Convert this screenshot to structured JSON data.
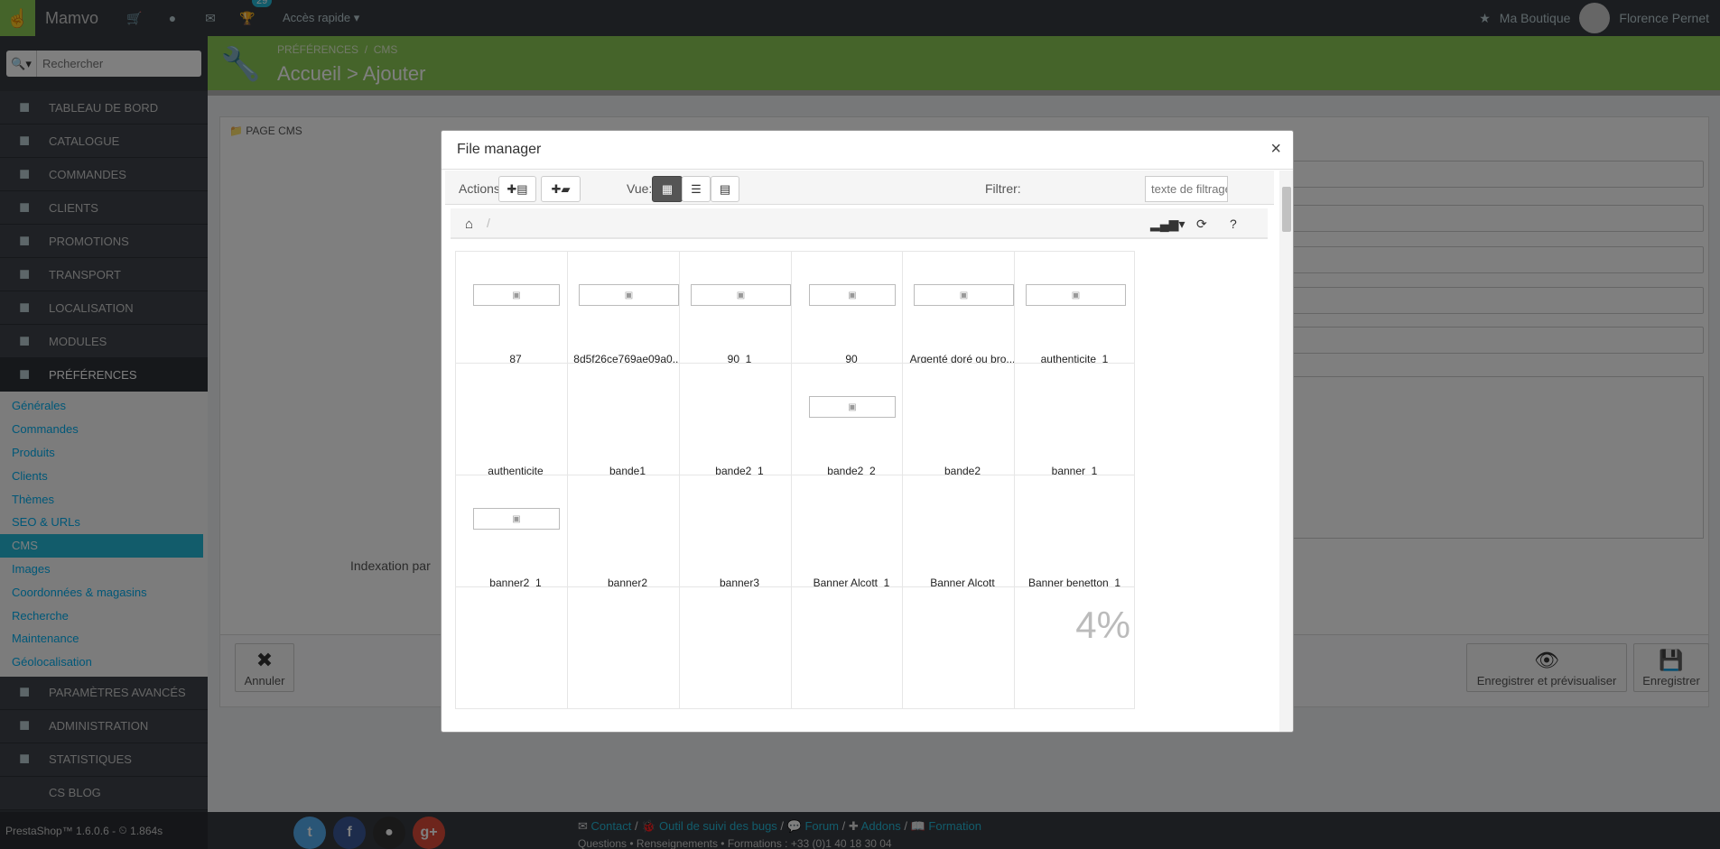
{
  "topbar": {
    "app_name": "Mamvo",
    "notif_count": "29",
    "quick_access": "Accès rapide",
    "shop_link": "Ma Boutique",
    "user_name": "Florence Pernet"
  },
  "search": {
    "placeholder": "Rechercher"
  },
  "menu": [
    {
      "label": "TABLEAU DE BORD",
      "icon": "dashboard-icon"
    },
    {
      "label": "CATALOGUE",
      "icon": "book-icon"
    },
    {
      "label": "COMMANDES",
      "icon": "credit-card-icon"
    },
    {
      "label": "CLIENTS",
      "icon": "users-icon"
    },
    {
      "label": "PROMOTIONS",
      "icon": "tags-icon"
    },
    {
      "label": "TRANSPORT",
      "icon": "truck-icon"
    },
    {
      "label": "LOCALISATION",
      "icon": "globe-icon"
    },
    {
      "label": "MODULES",
      "icon": "puzzle-icon"
    },
    {
      "label": "PRÉFÉRENCES",
      "icon": "wrench-icon"
    }
  ],
  "submenu": [
    "Générales",
    "Commandes",
    "Produits",
    "Clients",
    "Thèmes",
    "SEO & URLs",
    "CMS",
    "Images",
    "Coordonnées & magasins",
    "Recherche",
    "Maintenance",
    "Géolocalisation"
  ],
  "menu2": [
    {
      "label": "PARAMÈTRES AVANCÉS",
      "icon": "cogs-icon"
    },
    {
      "label": "ADMINISTRATION",
      "icon": "cog-icon"
    },
    {
      "label": "STATISTIQUES",
      "icon": "bar-chart-icon"
    },
    {
      "label": "CS BLOG",
      "icon": ""
    }
  ],
  "status": {
    "version": "PrestaShop™ 1.6.0.6 - ",
    "time": "1.864s"
  },
  "header": {
    "breadcrumb_1": "PRÉFÉRENCES",
    "breadcrumb_sep": "/",
    "breadcrumb_2": "CMS",
    "title": "Accueil > Ajouter"
  },
  "panel": {
    "heading": "PAGE CMS",
    "indexation_label": "Indexation par"
  },
  "buttons": {
    "cancel": "Annuler",
    "save_preview": "Enregistrer et prévisualiser",
    "save": "Enregistrer"
  },
  "footer": {
    "contact": "Contact",
    "bug_tracker": "Outil de suivi des bugs",
    "forum": "Forum",
    "addons": "Addons",
    "training": "Formation",
    "sub": "Questions • Renseignements • Formations : +33 (0)1 40 18 30 04"
  },
  "modal": {
    "title": "File manager",
    "close": "×",
    "actions_label": "Actions:",
    "view_label": "Vue:",
    "filter_label": "Filtrer:",
    "filter_placeholder": "texte de filtrage",
    "path_sep": "/",
    "loading_pct": "4%",
    "files": [
      {
        "name": "87",
        "thumb": true
      },
      {
        "name": "8d5f26ce769ae09a0...",
        "thumb": true
      },
      {
        "name": "90_1",
        "thumb": true
      },
      {
        "name": "90",
        "thumb": true
      },
      {
        "name": "Argenté doré ou bro...",
        "thumb": true
      },
      {
        "name": "authenticite_1",
        "thumb": true
      },
      {
        "name": "authenticite",
        "thumb": false
      },
      {
        "name": "bande1",
        "thumb": false
      },
      {
        "name": "bande2_1",
        "thumb": false
      },
      {
        "name": "bande2_2",
        "thumb": true
      },
      {
        "name": "bande2",
        "thumb": false
      },
      {
        "name": "banner_1",
        "thumb": false
      },
      {
        "name": "banner2_1",
        "thumb": true
      },
      {
        "name": "banner2",
        "thumb": false
      },
      {
        "name": "banner3",
        "thumb": false
      },
      {
        "name": "Banner Alcott_1",
        "thumb": false
      },
      {
        "name": "Banner Alcott",
        "thumb": false
      },
      {
        "name": "Banner benetton_1",
        "thumb": false
      },
      {
        "name": "",
        "thumb": false
      },
      {
        "name": "",
        "thumb": false
      },
      {
        "name": "",
        "thumb": false
      },
      {
        "name": "",
        "thumb": false
      },
      {
        "name": "",
        "thumb": false
      },
      {
        "name": "",
        "thumb": false
      }
    ]
  }
}
